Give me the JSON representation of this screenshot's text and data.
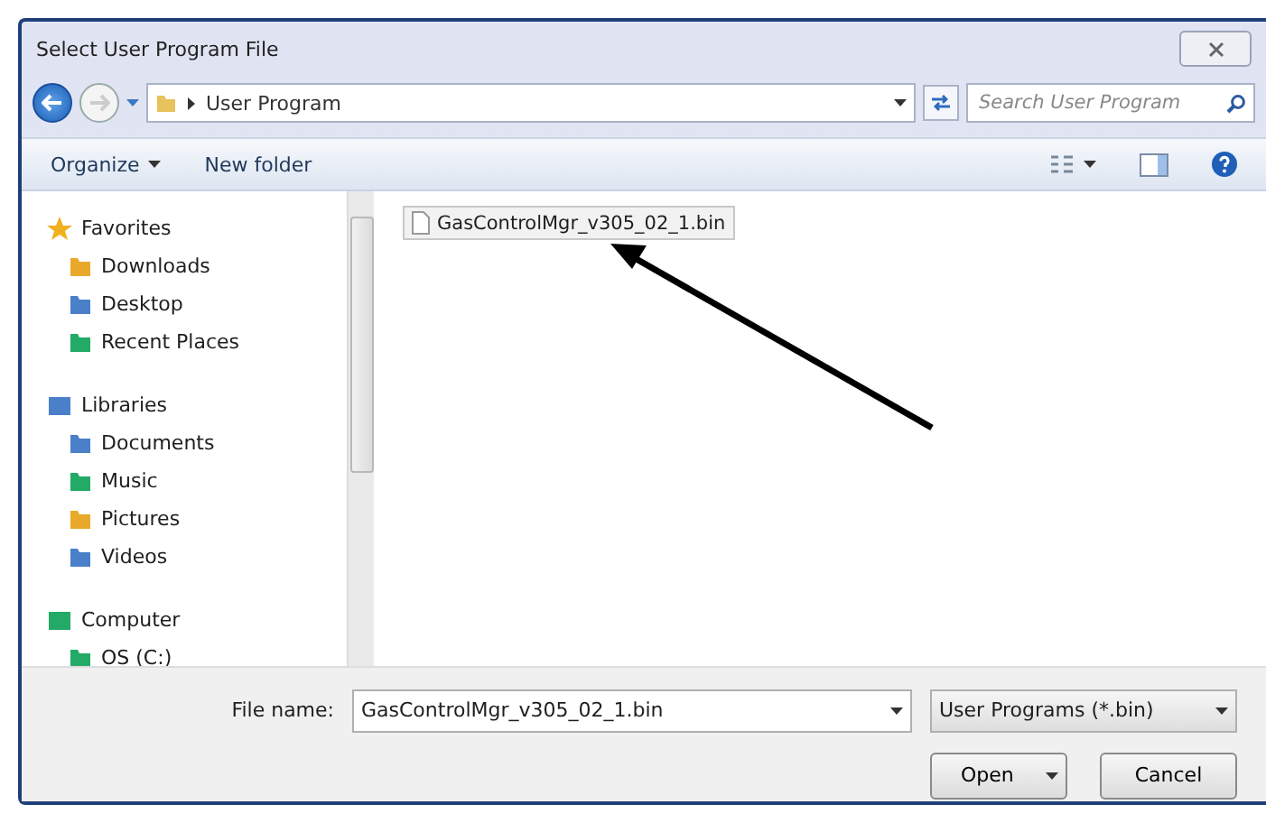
{
  "window": {
    "title": "Select User Program File"
  },
  "address_bar": {
    "path": "User Program",
    "search_placeholder": "Search User Program"
  },
  "toolbar": {
    "organize": "Organize",
    "new_folder": "New folder"
  },
  "sidebar": {
    "groups": [
      {
        "label": "Favorites",
        "children": [
          {
            "label": "Downloads"
          },
          {
            "label": "Desktop"
          },
          {
            "label": "Recent Places"
          }
        ]
      },
      {
        "label": "Libraries",
        "children": [
          {
            "label": "Documents"
          },
          {
            "label": "Music"
          },
          {
            "label": "Pictures"
          },
          {
            "label": "Videos"
          }
        ]
      },
      {
        "label": "Computer",
        "children": [
          {
            "label": "OS (C:)"
          }
        ]
      }
    ]
  },
  "files": [
    {
      "name": "GasControlMgr_v305_02_1.bin",
      "selected": true
    }
  ],
  "footer": {
    "file_name_label": "File name:",
    "file_name": "GasControlMgr_v305_02_1.bin",
    "file_type": "User Programs (*.bin)",
    "open": "Open",
    "cancel": "Cancel"
  }
}
